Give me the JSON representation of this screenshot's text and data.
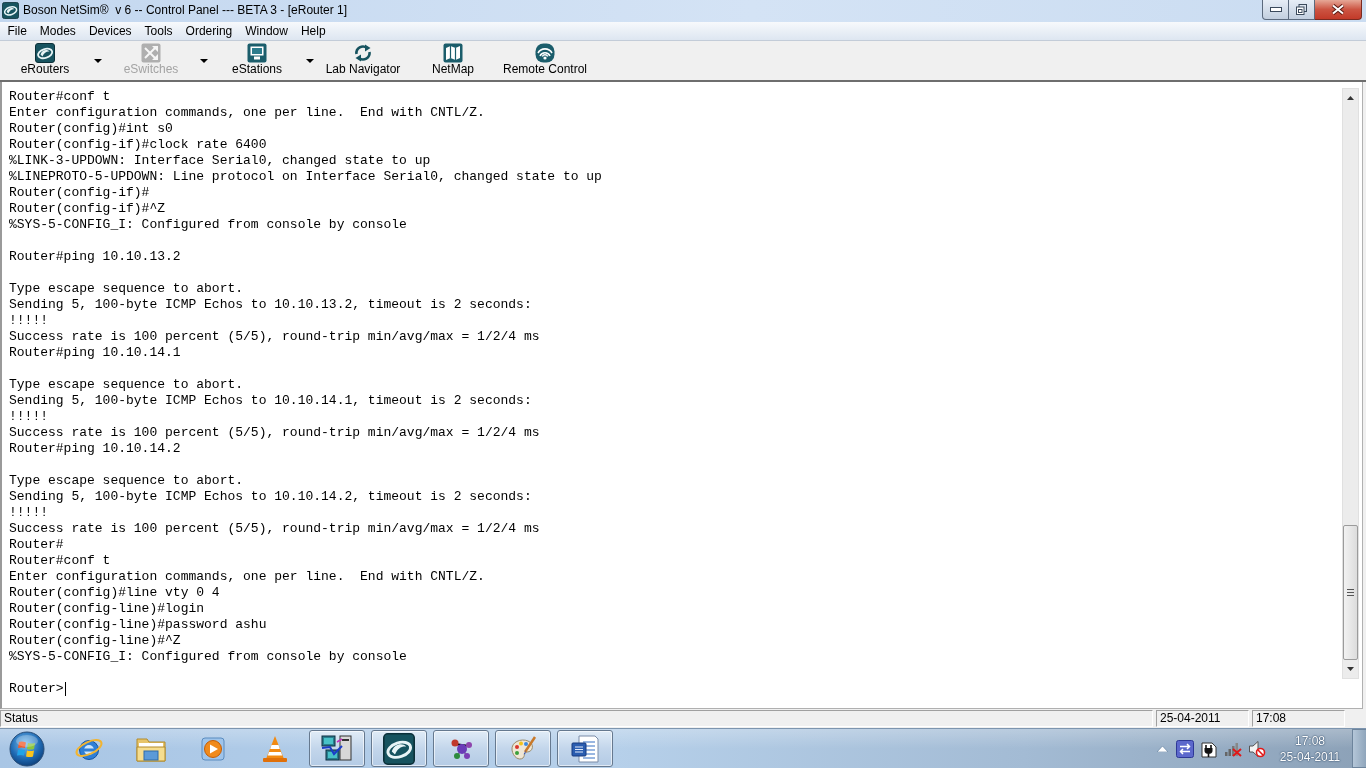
{
  "window": {
    "title": "Boson NetSim®  v 6 -- Control Panel --- BETA 3 - [eRouter 1]"
  },
  "menu": [
    "File",
    "Modes",
    "Devices",
    "Tools",
    "Ordering",
    "Window",
    "Help"
  ],
  "toolbar": [
    {
      "label": "eRouters",
      "disabled": false,
      "dropdown": true
    },
    {
      "label": "eSwitches",
      "disabled": true,
      "dropdown": true
    },
    {
      "label": "eStations",
      "disabled": false,
      "dropdown": true
    },
    {
      "label": "Lab Navigator",
      "disabled": false,
      "dropdown": false
    },
    {
      "label": "NetMap",
      "disabled": false,
      "dropdown": false
    },
    {
      "label": "Remote Control",
      "disabled": false,
      "dropdown": false
    }
  ],
  "terminal": {
    "blocks": [
      [
        "Router#conf t",
        "Enter configuration commands, one per line.  End with CNTL/Z.",
        "Router(config)#int s0",
        "Router(config-if)#clock rate 6400",
        "%LINK-3-UPDOWN: Interface Serial0, changed state to up",
        "%LINEPROTO-5-UPDOWN: Line protocol on Interface Serial0, changed state to up",
        "Router(config-if)#",
        "Router(config-if)#^Z",
        "%SYS-5-CONFIG_I: Configured from console by console"
      ],
      [
        "Router#ping 10.10.13.2"
      ],
      [
        "Type escape sequence to abort.",
        "Sending 5, 100-byte ICMP Echos to 10.10.13.2, timeout is 2 seconds:",
        "!!!!!",
        "Success rate is 100 percent (5/5), round-trip min/avg/max = 1/2/4 ms",
        "Router#ping 10.10.14.1"
      ],
      [
        "Type escape sequence to abort.",
        "Sending 5, 100-byte ICMP Echos to 10.10.14.1, timeout is 2 seconds:",
        "!!!!!",
        "Success rate is 100 percent (5/5), round-trip min/avg/max = 1/2/4 ms",
        "Router#ping 10.10.14.2"
      ],
      [
        "Type escape sequence to abort.",
        "Sending 5, 100-byte ICMP Echos to 10.10.14.2, timeout is 2 seconds:",
        "!!!!!",
        "Success rate is 100 percent (5/5), round-trip min/avg/max = 1/2/4 ms",
        "Router#",
        "Router#conf t",
        "Enter configuration commands, one per line.  End with CNTL/Z.",
        "Router(config)#line vty 0 4",
        "Router(config-line)#login",
        "Router(config-line)#password ashu",
        "Router(config-line)#^Z",
        "%SYS-5-CONFIG_I: Configured from console by console"
      ],
      [
        "Router>"
      ]
    ],
    "cursor": true
  },
  "status_bar": [
    "Status",
    "25-04-2011",
    "17:08"
  ],
  "taskbar": {
    "apps": [
      {
        "open": false
      },
      {
        "open": false
      },
      {
        "open": false
      },
      {
        "open": false
      },
      {
        "open": true
      },
      {
        "open": true
      },
      {
        "open": true
      },
      {
        "open": true
      },
      {
        "open": true
      }
    ],
    "clock": {
      "time": "17:08",
      "date": "25-04-2011"
    }
  }
}
